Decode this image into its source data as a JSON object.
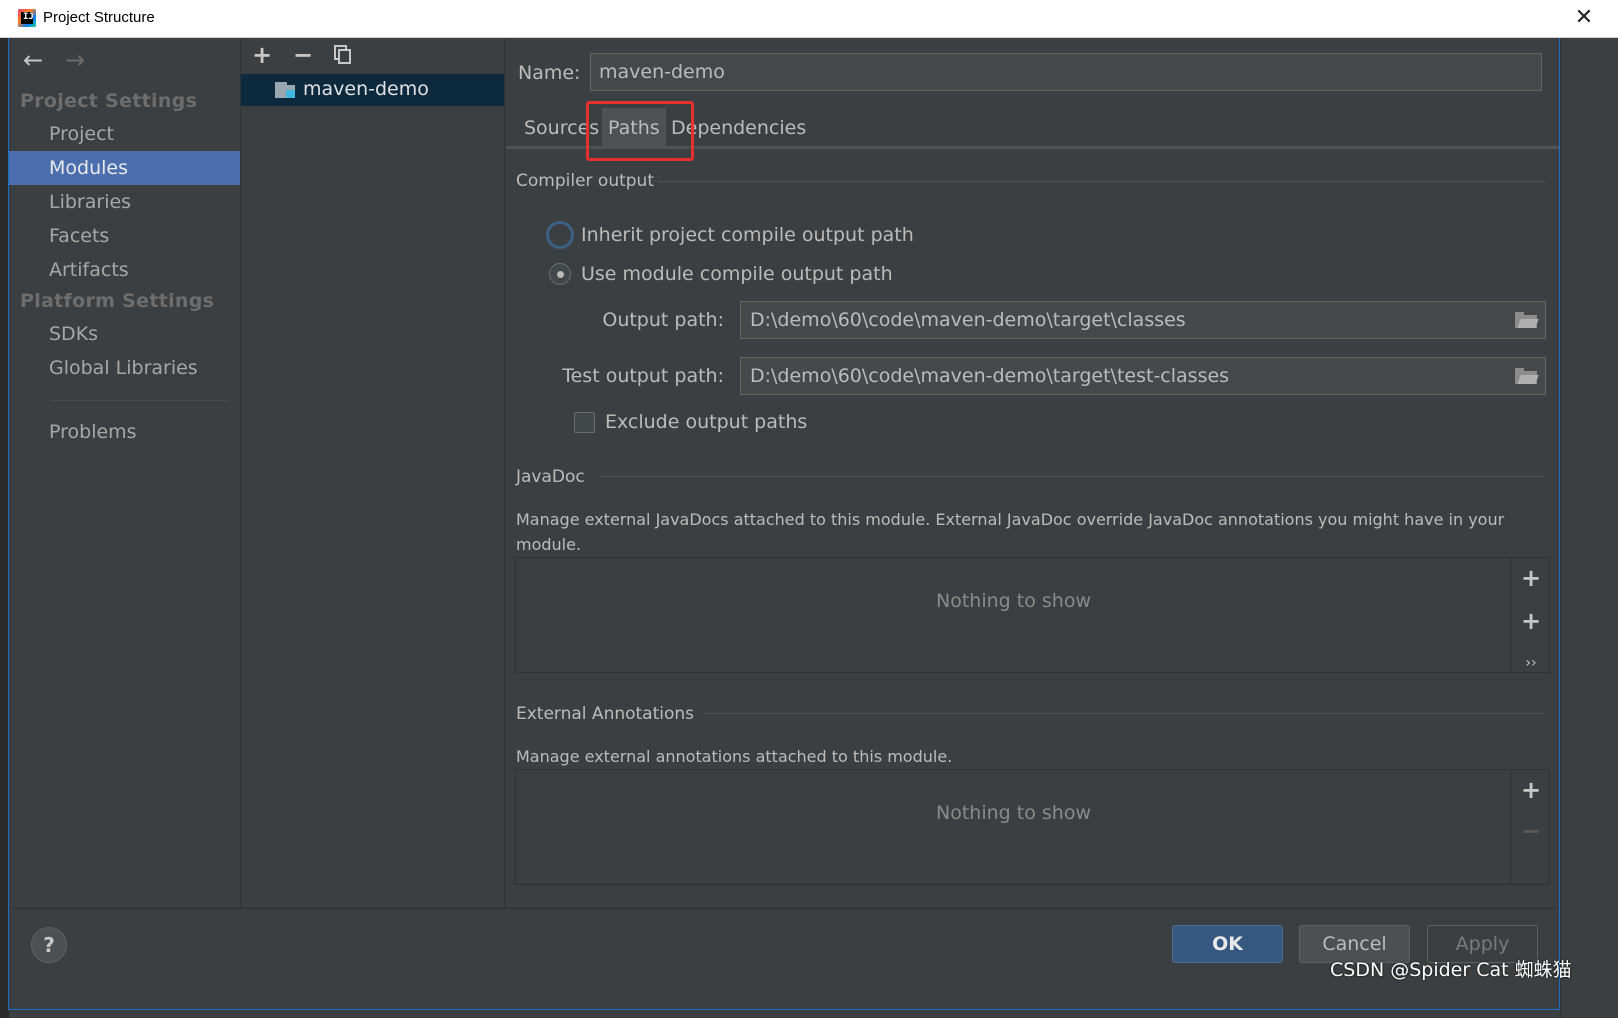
{
  "window": {
    "title": "Project Structure",
    "close_glyph": "✕"
  },
  "sidebar": {
    "back_glyph": "←",
    "forward_glyph": "→",
    "project_settings_title": "Project Settings",
    "project_items": [
      "Project",
      "Modules",
      "Libraries",
      "Facets",
      "Artifacts"
    ],
    "selected_item": "Modules",
    "platform_settings_title": "Platform Settings",
    "platform_items": [
      "SDKs",
      "Global Libraries"
    ],
    "problems_label": "Problems"
  },
  "modules_panel": {
    "add_glyph": "+",
    "remove_glyph": "−",
    "module_name": "maven-demo"
  },
  "content": {
    "name_label": "Name:",
    "name_value": "maven-demo",
    "tabs": [
      "Sources",
      "Paths",
      "Dependencies"
    ],
    "active_tab": "Paths",
    "compiler_output": {
      "title": "Compiler output",
      "inherit_option": "Inherit project compile output path",
      "module_option": "Use module compile output path",
      "selected_option": "Use module compile output path",
      "output_path_label": "Output path:",
      "output_path_value": "D:\\demo\\60\\code\\maven-demo\\target\\classes",
      "test_output_path_label": "Test output path:",
      "test_output_path_value": "D:\\demo\\60\\code\\maven-demo\\target\\test-classes",
      "exclude_label": "Exclude output paths",
      "exclude_checked": false
    },
    "javadoc": {
      "title": "JavaDoc",
      "description": "Manage external JavaDocs attached to this module. External JavaDoc override JavaDoc annotations you might have in your module.",
      "empty_text": "Nothing to show",
      "add_glyph": "+",
      "add_url_glyph": "+",
      "more_glyph": "››"
    },
    "external_annotations": {
      "title": "External Annotations",
      "description": "Manage external annotations attached to this module.",
      "empty_text": "Nothing to show",
      "add_glyph": "+",
      "remove_glyph": "−"
    }
  },
  "footer": {
    "help_glyph": "?",
    "ok_label": "OK",
    "cancel_label": "Cancel",
    "apply_label": "Apply"
  },
  "watermark": "CSDN @Spider Cat 蜘蛛猫",
  "colors": {
    "background": "#3c3f41",
    "selection": "#4b6eaf",
    "highlight_box": "#e53030",
    "ok_button": "#365880"
  }
}
